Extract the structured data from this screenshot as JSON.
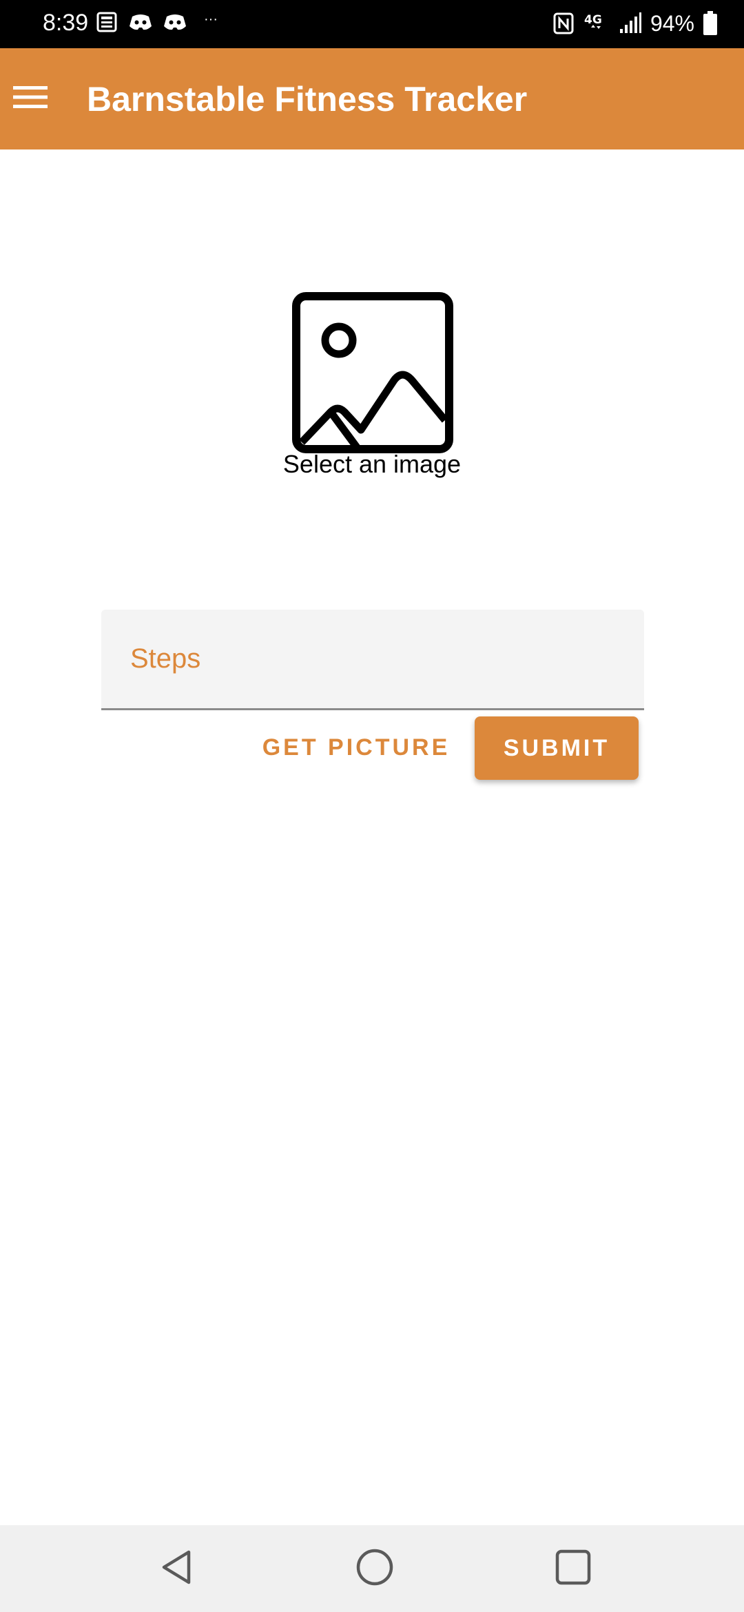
{
  "status_bar": {
    "time": "8:39",
    "battery_percent": "94%",
    "network": "4G",
    "left_icons": [
      "news-icon",
      "discord-icon",
      "discord-icon",
      "more-dots-icon"
    ],
    "right_icons": [
      "nfc-icon",
      "network-4g-icon",
      "signal-icon",
      "battery-icon"
    ],
    "more_dots": "···"
  },
  "app_bar": {
    "title": "Barnstable Fitness Tracker",
    "menu_icon": "hamburger-menu-icon"
  },
  "image_picker": {
    "icon": "image-placeholder-icon",
    "label": "Select an image"
  },
  "form": {
    "steps_placeholder": "Steps",
    "steps_value": ""
  },
  "buttons": {
    "get_picture_label": "GET PICTURE",
    "submit_label": "SUBMIT"
  },
  "nav_bar": {
    "back_icon": "back-triangle-icon",
    "home_icon": "home-circle-icon",
    "recents_icon": "recents-square-icon"
  },
  "colors": {
    "primary": "#dc883b",
    "status_bar": "#000000",
    "nav_bar": "#f0f0f0",
    "field_background": "#f4f4f4"
  }
}
